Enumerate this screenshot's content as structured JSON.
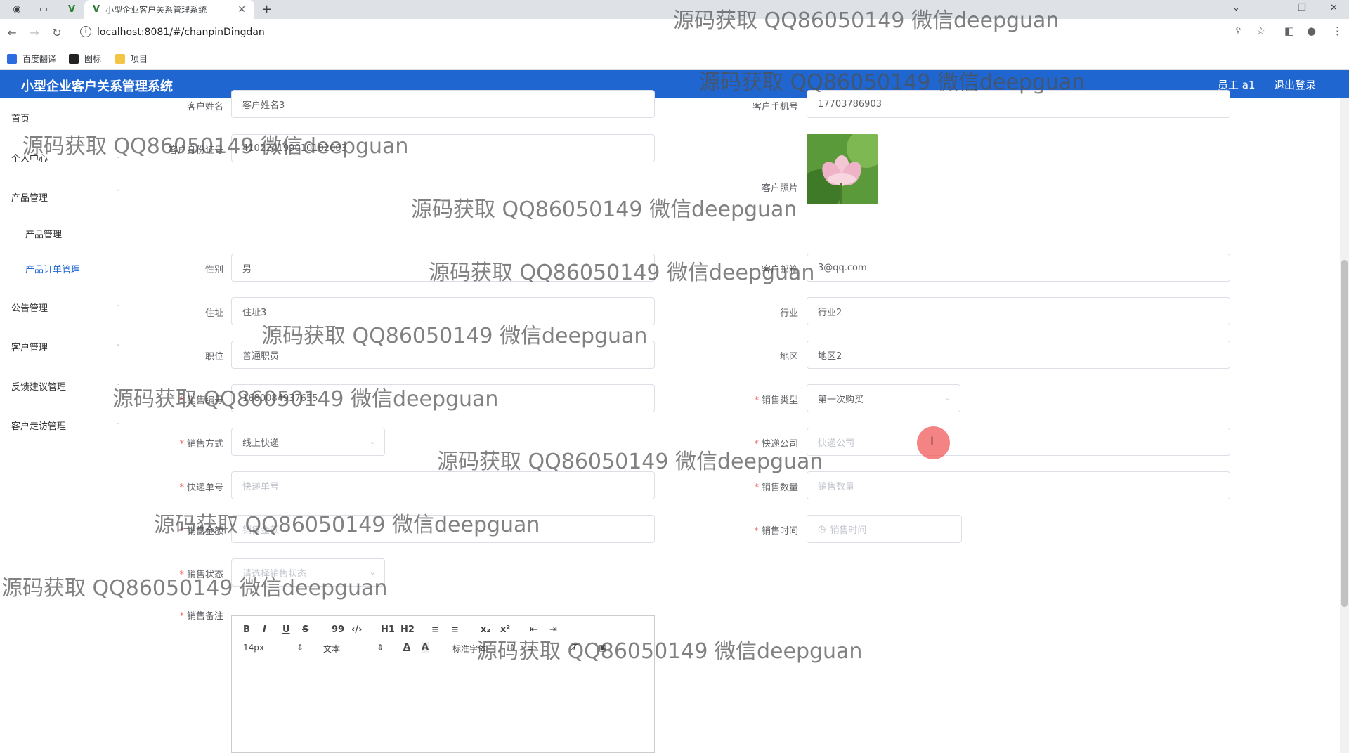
{
  "browser": {
    "tab_title": "小型企业客户关系管理系统",
    "url": "localhost:8081/#/chanpinDingdan",
    "bookmarks": [
      "百度翻译",
      "图标",
      "项目"
    ]
  },
  "header": {
    "title": "小型企业客户关系管理系统",
    "user": "员工 a1",
    "logout": "退出登录"
  },
  "sidebar": {
    "items": [
      {
        "label": "首页"
      },
      {
        "label": "个人中心"
      },
      {
        "label": "产品管理"
      },
      {
        "label": "产品管理"
      },
      {
        "label": "产品订单管理"
      },
      {
        "label": "公告管理"
      },
      {
        "label": "客户管理"
      },
      {
        "label": "反馈建议管理"
      },
      {
        "label": "客户走访管理"
      }
    ]
  },
  "form": {
    "customer_name": {
      "label": "客户姓名",
      "value": "客户姓名3"
    },
    "customer_phone": {
      "label": "客户手机号",
      "value": "17703786903"
    },
    "customer_id": {
      "label": "客户身份证号",
      "value": "410224199010102003"
    },
    "customer_photo": {
      "label": "客户照片"
    },
    "gender": {
      "label": "性别",
      "value": "男"
    },
    "email": {
      "label": "客户邮箱",
      "value": "3@qq.com"
    },
    "address": {
      "label": "住址",
      "value": "住址3"
    },
    "industry": {
      "label": "行业",
      "value": "行业2"
    },
    "position": {
      "label": "职位",
      "value": "普通职员"
    },
    "region": {
      "label": "地区",
      "value": "地区2"
    },
    "sale_no": {
      "label": "销售编号",
      "value": "1680084937655"
    },
    "sale_type": {
      "label": "销售类型",
      "value": "第一次购买"
    },
    "sale_method": {
      "label": "销售方式",
      "value": "线上快递"
    },
    "courier": {
      "label": "快递公司",
      "placeholder": "快递公司"
    },
    "tracking_no": {
      "label": "快递单号",
      "placeholder": "快递单号"
    },
    "sale_qty": {
      "label": "销售数量",
      "placeholder": "销售数量"
    },
    "sale_amount": {
      "label": "销售金额",
      "placeholder": "销售金额"
    },
    "sale_time": {
      "label": "销售时间",
      "placeholder": "销售时间"
    },
    "sale_status": {
      "label": "销售状态",
      "placeholder": "请选择销售状态"
    },
    "sale_note": {
      "label": "销售备注"
    }
  },
  "editor": {
    "font_size": "14px",
    "text_style": "文本",
    "font_family": "标准字体",
    "buttons": [
      "B",
      "I",
      "U",
      "S",
      "99",
      "‹/›",
      "H1",
      "H2",
      "≡",
      "≡",
      "x₂",
      "x²",
      "⇤",
      "⇥",
      "A",
      "A"
    ]
  },
  "watermark": "源码获取 QQ86050149 微信deepguan",
  "colors": {
    "header": "#1f66d0",
    "active": "#1f66d0",
    "required": "#f56c6c"
  }
}
